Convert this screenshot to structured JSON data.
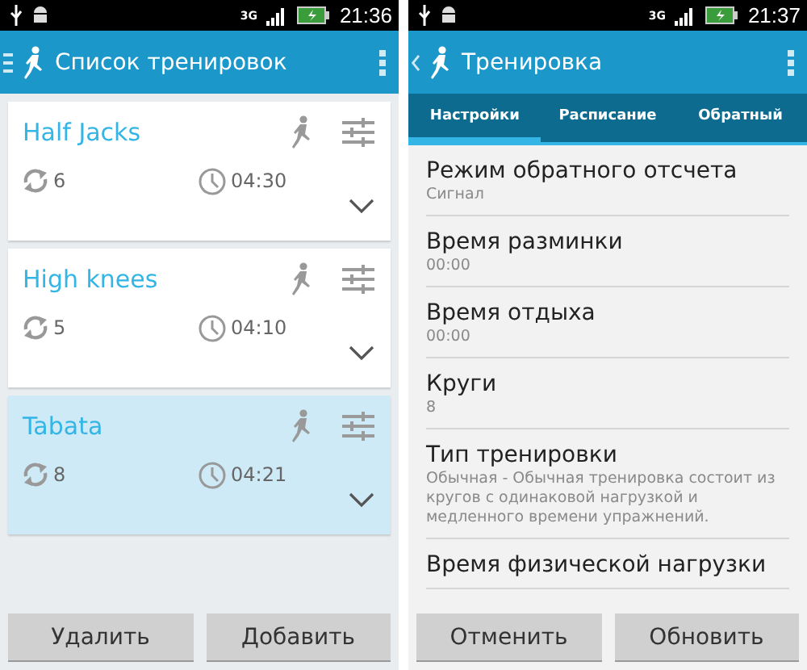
{
  "list_screen": {
    "status_bar": {
      "network": "3G",
      "time": "21:36"
    },
    "app_bar": {
      "title": "Список тренировок"
    },
    "workouts": [
      {
        "name": "Half Jacks",
        "rounds": "6",
        "duration": "04:30",
        "selected": false
      },
      {
        "name": "High knees",
        "rounds": "5",
        "duration": "04:10",
        "selected": false
      },
      {
        "name": "Tabata",
        "rounds": "8",
        "duration": "04:21",
        "selected": true
      }
    ],
    "buttons": [
      "Удалить",
      "Добавить"
    ]
  },
  "detail_screen": {
    "status_bar": {
      "network": "3G",
      "time": "21:37"
    },
    "app_bar": {
      "title": "Тренировка"
    },
    "tabs": [
      {
        "label": "Настройки",
        "selected": true
      },
      {
        "label": "Расписание",
        "selected": false
      },
      {
        "label": "Обратный",
        "selected": false
      }
    ],
    "settings": [
      {
        "title": "Режим обратного отсчета",
        "value": "Сигнал"
      },
      {
        "title": "Время разминки",
        "value": "00:00"
      },
      {
        "title": "Время отдыха",
        "value": "00:00"
      },
      {
        "title": "Круги",
        "value": "8"
      },
      {
        "title": "Тип тренировки",
        "value": "Обычная - Обычная тренировка состоит из кругов с одинаковой нагрузкой и медленного времени упражнений."
      },
      {
        "title": "Время физической нагрузки"
      }
    ],
    "buttons": [
      "Отменить",
      "Обновить"
    ]
  }
}
